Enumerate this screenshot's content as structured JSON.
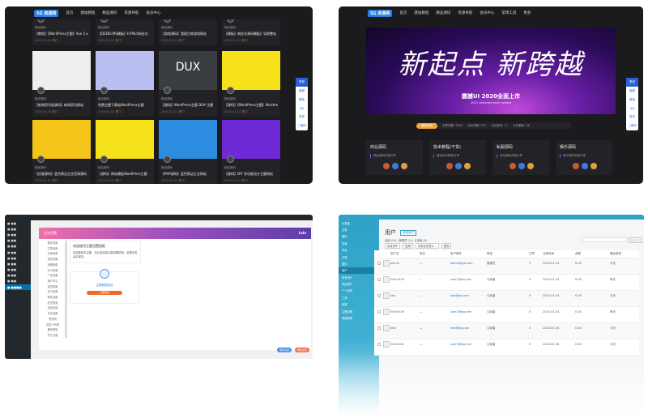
{
  "q1": {
    "logo": "5G 资源网",
    "nav": [
      "首页",
      "建站教程",
      "精品源码",
      "资源导航",
      "会员中心"
    ],
    "cards": [
      {
        "cat": "精品源码",
        "title": "【教程】【WordPress主题】Vue 2.x",
        "meta": "2020-01-01",
        "tag": "热门",
        "color": "#8a5b3a"
      },
      {
        "cat": "精品源码",
        "title": "【DEDECMS模板】HTML5响应式",
        "meta": "2020-01-01",
        "tag": "热门",
        "color": "#c9b27a"
      },
      {
        "cat": "精品源码",
        "title": "【游戏源码】我国古典游戏网站",
        "meta": "2020-01-01",
        "tag": "热门",
        "color": "#c9c9c9"
      },
      {
        "cat": "精品源码",
        "title": "【模板】响应式源码模板】导航整站",
        "meta": "2020-01-01",
        "tag": "热门",
        "color": "#e05a3a"
      },
      {
        "cat": "精品源码",
        "title": "【新闻资讯类源码】新闻资讯网站",
        "meta": "2020-01-01",
        "tag": "热门",
        "color": "#eeeeee"
      },
      {
        "cat": "精品源码",
        "title": "免费主题下载站WordPress主题",
        "meta": "2020-01-01",
        "tag": "热门",
        "color": "#b9bdf0"
      },
      {
        "cat": "精品源码",
        "title": "【源码】WordPress主题 DUX 主题",
        "meta": "2020-01-01",
        "tag": "热门",
        "color": "#3a3d42",
        "text": "DUX"
      },
      {
        "cat": "精品源码",
        "title": "【源码】【WordPress主题】Nicetheme",
        "meta": "2020-01-01",
        "tag": "热门",
        "color": "#f5e21a"
      },
      {
        "cat": "精品源码",
        "title": "【优惠源码】蓝色简洁企业官网源码",
        "meta": "2020-01-01",
        "tag": "热门",
        "color": "#f5c51a"
      },
      {
        "cat": "精品源码",
        "title": "【源码】网站模板WordPress主题",
        "meta": "2020-01-01",
        "tag": "热门",
        "color": "#f5e21a"
      },
      {
        "cat": "精品源码",
        "title": "【PHP源码】蓝色简洁企业网站",
        "meta": "2020-01-01",
        "tag": "热门",
        "color": "#2b8ce0"
      },
      {
        "cat": "精品源码",
        "title": "【源码】DIY 多功能设计主题网站",
        "meta": "2020-01-01",
        "tag": "热门",
        "color": "#6d2ad6"
      }
    ],
    "float": [
      "签到",
      "客服",
      "微信",
      "QQ",
      "发布",
      "二维码"
    ]
  },
  "q2": {
    "logo": "5G 资源网",
    "nav": [
      "首页",
      "建站教程",
      "精品源码",
      "资源导航",
      "会员中心",
      "常用工具",
      "更多"
    ],
    "banner_title": "新起点 新跨越",
    "banner_sub": "震撼UI 2020全面上市",
    "banner_sub2": "2020 comprehensive update",
    "stats_highlight": "最新动态",
    "stats": [
      "文章总数: 2922",
      "评论总数: 557",
      "今日发布: 17",
      "今日更新: 18"
    ],
    "boxes": [
      {
        "title": "商业源码",
        "desc": "精品源码资源分享"
      },
      {
        "title": "技术教程(干货)",
        "desc": "建站技术教程分享"
      },
      {
        "title": "私服源码",
        "desc": "游戏源码资源分享"
      },
      {
        "title": "娱乐源码",
        "desc": "娱乐源码资源分享"
      }
    ],
    "float": [
      "签到",
      "客服",
      "微信",
      "QQ",
      "发布",
      "二维码"
    ]
  },
  "q3": {
    "header": "后台设置",
    "header_right": "Lolo",
    "menu": [
      "基本设置",
      "文章设置",
      "分类设置",
      "首页设置",
      "页脚设置",
      "SEO设置",
      "广告设置",
      "用户中心",
      "会员设置",
      "支付设置",
      "邮件设置",
      "社交登录",
      "优化加速",
      "评论设置",
      "短代码",
      "自定义代码",
      "备份恢复",
      "关于主题"
    ],
    "notice_title": "欢迎使用主题设置面板",
    "notice_text": "欢迎使用本主题，请认真阅读主题设置说明，设置完成后请保存。",
    "auth_link": "主题授权验证",
    "auth_button": "立即授权",
    "save": "保存设置",
    "reset": "重置设置"
  },
  "q4": {
    "title": "用户",
    "add_new": "添加用户",
    "filters": "全部 (10) | 管理员 (1) | 订阅者 (9)",
    "bulk": "批量操作",
    "apply": "应用",
    "role_change": "将角色变更为...",
    "change": "更改",
    "search_button": "搜索用户",
    "columns": [
      "用户名",
      "姓名",
      "电子邮件",
      "角色",
      "文章",
      "注册时间",
      "余额",
      "最后登录"
    ],
    "rows": [
      [
        "admin",
        "—",
        "admin@qq.com",
        "管理员",
        "3",
        "2020-01-01",
        "0.00",
        "今天"
      ],
      [
        "5ef1a23d",
        "—",
        "user1@qq.com",
        "订阅者",
        "0",
        "2020-01-02",
        "0.00",
        "昨天"
      ],
      [
        "lolo",
        "—",
        "lolo@qq.com",
        "订阅者",
        "0",
        "2020-01-03",
        "0.00",
        "今天"
      ],
      [
        "5ef2b33d",
        "—",
        "user2@qq.com",
        "订阅者",
        "0",
        "2020-01-04",
        "0.00",
        "昨天"
      ],
      [
        "test",
        "—",
        "test@qq.com",
        "订阅者",
        "0",
        "2020-01-05",
        "0.00",
        "今天"
      ],
      [
        "5ef3c44d",
        "—",
        "user3@qq.com",
        "订阅者",
        "0",
        "2020-01-06",
        "0.00",
        "今天"
      ]
    ],
    "sidebar": [
      "仪表盘",
      "文章",
      "媒体",
      "页面",
      "评论",
      "外观",
      "插件",
      "用户",
      "所有用户",
      "添加用户",
      "个人资料",
      "工具",
      "设置",
      "主题设置",
      "收起菜单"
    ]
  }
}
